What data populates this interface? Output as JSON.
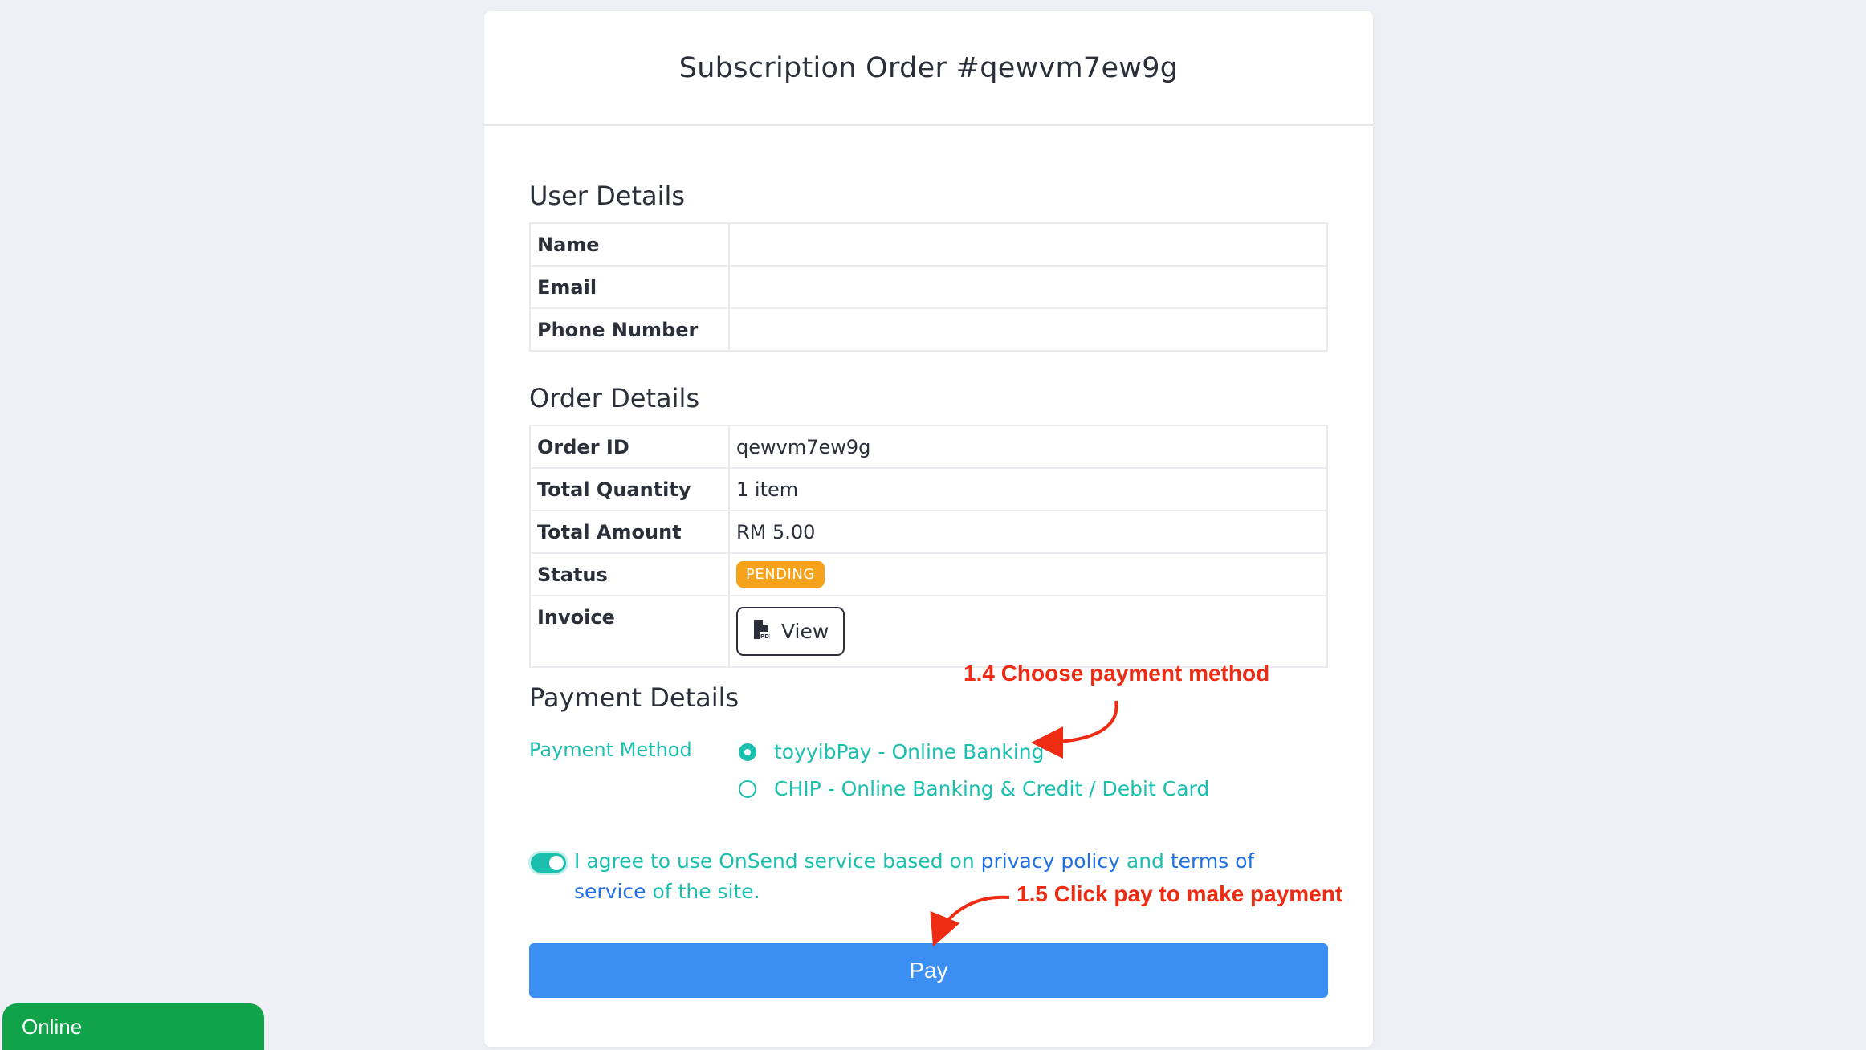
{
  "header": {
    "title": "Subscription Order #qewvm7ew9g"
  },
  "user_details": {
    "title": "User Details",
    "rows": [
      {
        "label": "Name",
        "value": ""
      },
      {
        "label": "Email",
        "value": ""
      },
      {
        "label": "Phone Number",
        "value": ""
      }
    ]
  },
  "order_details": {
    "title": "Order Details",
    "order_id_label": "Order ID",
    "order_id": "qewvm7ew9g",
    "quantity_label": "Total Quantity",
    "quantity": "1 item",
    "amount_label": "Total Amount",
    "amount": "RM 5.00",
    "status_label": "Status",
    "status": "PENDING",
    "invoice_label": "Invoice",
    "view_label": "View"
  },
  "payment_details": {
    "title": "Payment Details",
    "method_label": "Payment Method",
    "options": [
      {
        "label": "toyyibPay - Online Banking",
        "selected": true
      },
      {
        "label": "CHIP - Online Banking & Credit / Debit Card",
        "selected": false
      }
    ]
  },
  "agreement": {
    "checked": true,
    "text_before": "I agree to use OnSend service based on ",
    "privacy_link": "privacy policy",
    "text_and": " and ",
    "terms_link": "terms of service",
    "text_after": " of the site."
  },
  "pay_button": {
    "label": "Pay"
  },
  "annotations": {
    "step_1_4": "1.4 Choose payment method",
    "step_1_5": "1.5 Click pay to make payment"
  },
  "online_badge": {
    "label": "Online"
  },
  "colors": {
    "accent_teal": "#1bbfae",
    "pay_blue": "#3b8ff2",
    "link_blue": "#1e6fe6",
    "pending_orange": "#f7a21b",
    "annotation_red": "#ee2b13",
    "online_green": "#10a34a"
  }
}
